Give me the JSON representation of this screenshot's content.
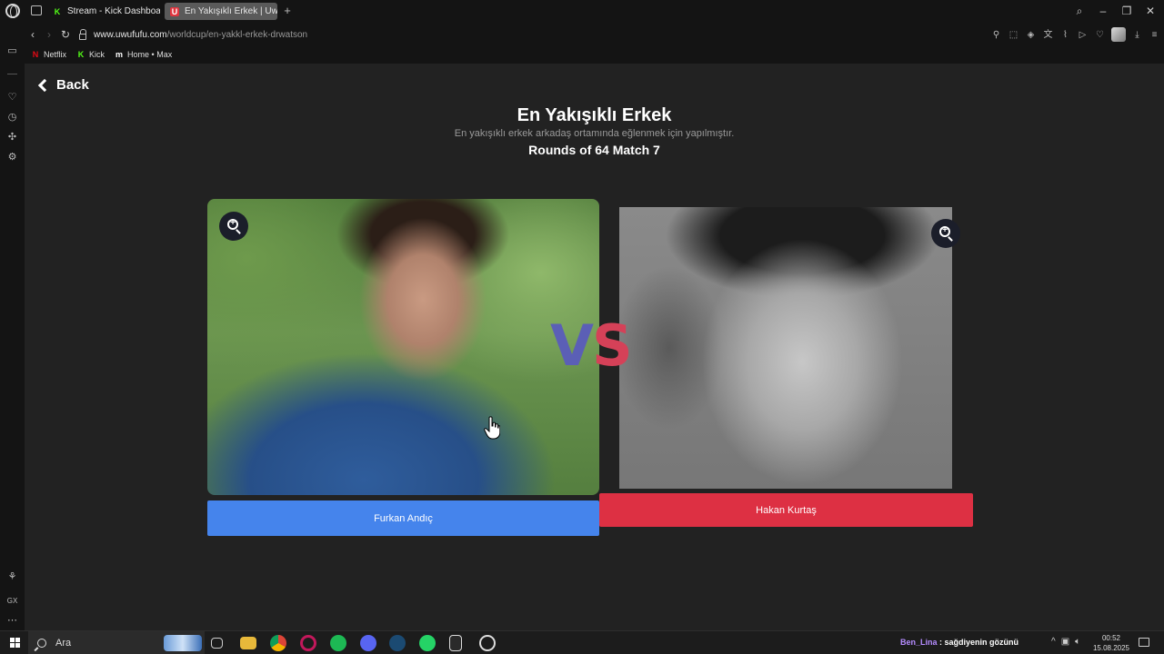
{
  "browser": {
    "tabs": [
      {
        "label": "Stream - Kick Dashboard",
        "favicon": "K"
      },
      {
        "label": "En Yakışıklı Erkek | UwUFufu",
        "favicon": "U"
      }
    ],
    "new_tab": "+",
    "url_domain": "www.uwufufu.com",
    "url_path": "/worldcup/en-yakkl-erkek-drwatson",
    "bookmarks": [
      {
        "label": "Netflix",
        "icon": "N"
      },
      {
        "label": "Kick",
        "icon": "K"
      },
      {
        "label": "Home • Max",
        "icon": "m"
      }
    ]
  },
  "page": {
    "back_label": "Back",
    "title": "En Yakışıklı Erkek",
    "subtitle": "En yakışıklı erkek arkadaş ortamında eğlenmek için yapılmıştır.",
    "round_info": "Rounds of 64 Match 7",
    "vs_v": "V",
    "vs_s": "S",
    "left_candidate": "Furkan Andıç",
    "right_candidate": "Hakan Kurtaş"
  },
  "taskbar": {
    "search_placeholder": "Ara",
    "tray_user": "Ben_Lina",
    "tray_message": " : sağdiyenin gözünü",
    "time": "00:52",
    "date": "15.08.2025"
  },
  "colors": {
    "left_button": "#4584ec",
    "right_button": "#dd3043",
    "vs_v": "#5b5fb6",
    "vs_s": "#d54158",
    "page_bg": "#222222"
  },
  "icons": {
    "zoom": "zoom-in-icon",
    "back": "chevron-left-icon",
    "lock": "lock-icon"
  }
}
